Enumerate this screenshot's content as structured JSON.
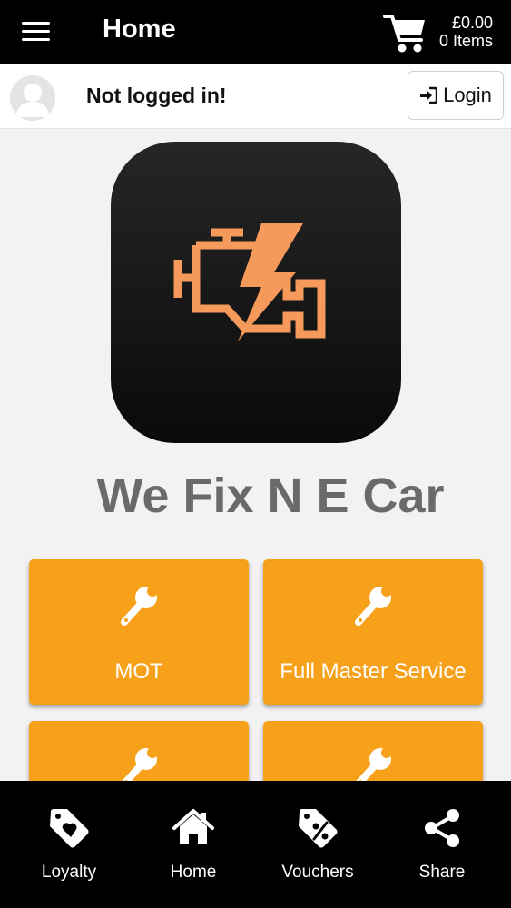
{
  "header": {
    "title": "Home",
    "menu_icon": "hamburger-menu-icon",
    "cart": {
      "icon": "shopping-cart-icon",
      "total": "£0.00",
      "items": "0 Items"
    }
  },
  "user": {
    "avatar_icon": "default-avatar-icon",
    "status": "Not logged in!",
    "login_label": "Login",
    "login_icon": "sign-in-icon"
  },
  "main": {
    "logo_icon": "check-engine-icon",
    "business_name": "We Fix N E Car",
    "tiles": [
      {
        "label": "MOT",
        "icon": "wrench-icon"
      },
      {
        "label": "Full Master Service",
        "icon": "wrench-icon"
      },
      {
        "label": "",
        "icon": "wrench-icon"
      },
      {
        "label": "",
        "icon": "wrench-icon"
      }
    ]
  },
  "bottom_nav": [
    {
      "label": "Loyalty",
      "icon": "heart-tag-icon"
    },
    {
      "label": "Home",
      "icon": "home-icon"
    },
    {
      "label": "Vouchers",
      "icon": "percent-tag-icon"
    },
    {
      "label": "Share",
      "icon": "share-icon"
    }
  ],
  "colors": {
    "bar_background": "#000000",
    "tile_orange": "#f7a11a",
    "logo_orange": "#f59a5a",
    "business_name_gray": "#6a6a6a"
  }
}
